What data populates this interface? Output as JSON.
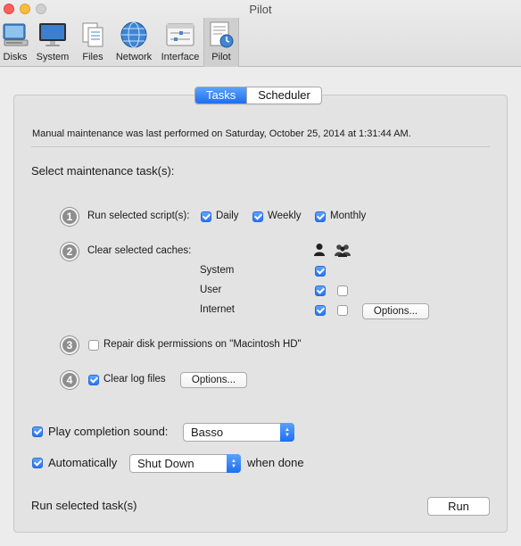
{
  "window": {
    "title": "Pilot"
  },
  "toolbar": {
    "items": [
      {
        "label": "Disks",
        "icon": "disks-icon"
      },
      {
        "label": "System",
        "icon": "system-icon"
      },
      {
        "label": "Files",
        "icon": "files-icon"
      },
      {
        "label": "Network",
        "icon": "network-icon"
      },
      {
        "label": "Interface",
        "icon": "interface-icon"
      },
      {
        "label": "Pilot",
        "icon": "pilot-icon",
        "selected": true
      }
    ]
  },
  "tabs": [
    {
      "label": "Tasks",
      "active": true
    },
    {
      "label": "Scheduler",
      "active": false
    }
  ],
  "status": {
    "last_performed": "Manual maintenance was last performed on Saturday, October 25, 2014 at 1:31:44 AM."
  },
  "section_title": "Select maintenance task(s):",
  "task1": {
    "number": "1",
    "label": "Run selected script(s):",
    "options": [
      {
        "label": "Daily",
        "checked": true
      },
      {
        "label": "Weekly",
        "checked": true
      },
      {
        "label": "Monthly",
        "checked": true
      }
    ]
  },
  "task2": {
    "number": "2",
    "label": "Clear selected caches:",
    "column_icons": [
      "single-user-icon",
      "all-users-icon"
    ],
    "rows": [
      {
        "label": "System",
        "user": true,
        "all_users": null
      },
      {
        "label": "User",
        "user": true,
        "all_users": false
      },
      {
        "label": "Internet",
        "user": true,
        "all_users": false
      }
    ],
    "options_label": "Options..."
  },
  "task3": {
    "number": "3",
    "label": "Repair disk permissions on \"Macintosh HD\"",
    "checked": false
  },
  "task4": {
    "number": "4",
    "label": "Clear log files",
    "checked": true,
    "options_label": "Options..."
  },
  "completion_sound": {
    "label": "Play completion sound:",
    "checked": true,
    "value": "Basso"
  },
  "auto_action": {
    "label": "Automatically",
    "checked": true,
    "value": "Shut Down",
    "suffix": "when done"
  },
  "footer": {
    "label": "Run selected task(s)",
    "run_label": "Run"
  },
  "colors": {
    "accent": "#2674f2",
    "panel": "#e3e3e3",
    "window": "#ececec"
  }
}
